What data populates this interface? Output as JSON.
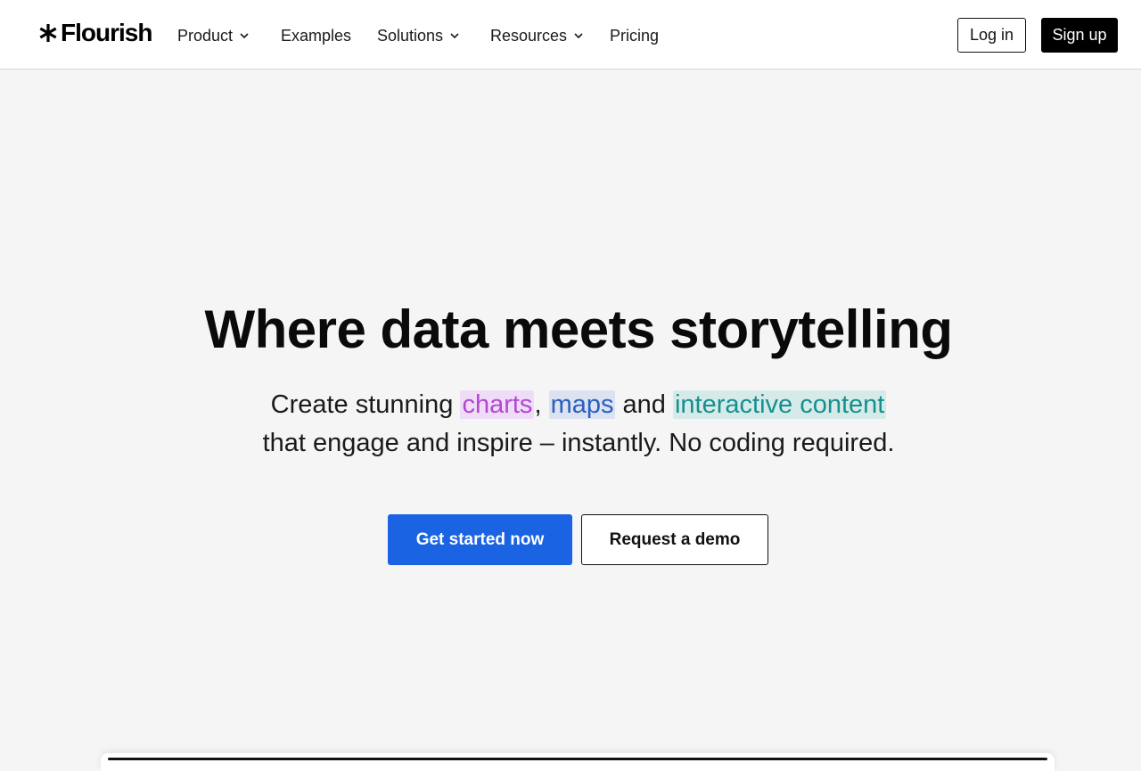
{
  "brand": {
    "name": "Flourish"
  },
  "nav": {
    "items": [
      {
        "label": "Product",
        "dropdown": true
      },
      {
        "label": "Examples",
        "dropdown": false
      },
      {
        "label": "Solutions",
        "dropdown": true
      },
      {
        "label": "Resources",
        "dropdown": true
      },
      {
        "label": "Pricing",
        "dropdown": false
      }
    ],
    "login_label": "Log in",
    "signup_label": "Sign up"
  },
  "hero": {
    "title": "Where data meets storytelling",
    "subtitle": {
      "prefix": "Create stunning ",
      "charts": "charts",
      "comma": ",",
      "maps": "maps",
      "and": " and ",
      "interactive": "interactive content",
      "line2": "that engage and inspire – instantly. No coding required."
    },
    "primary_cta": "Get started now",
    "secondary_cta": "Request a demo"
  },
  "colors": {
    "primary_button": "#1a64e3",
    "charts_highlight": "#b446d6",
    "maps_highlight": "#2a5fbf",
    "interactive_highlight": "#15908f"
  }
}
